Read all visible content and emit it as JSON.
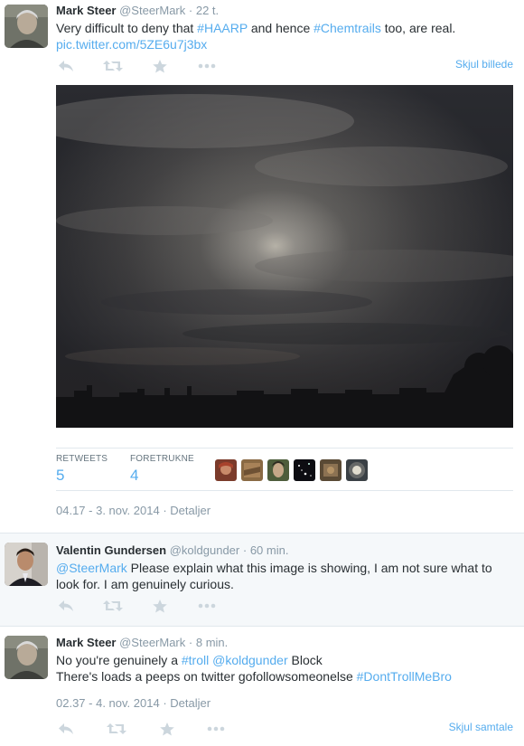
{
  "tweet_main": {
    "fullname": "Mark Steer",
    "username": "@SteerMark",
    "time": "· 22 t.",
    "text_pre": "Very difficult to deny that ",
    "hashtag1": "#HAARP",
    "text_mid": " and hence ",
    "hashtag2": "#Chemtrails",
    "text_post": " too, are real.",
    "pic_link": "pic.twitter.com/5ZE6u7j3bx",
    "hide_image": "Skjul billede",
    "retweets_label": "RETWEETS",
    "retweets_count": "5",
    "favorites_label": "FORETRUKNE",
    "favorites_count": "4",
    "timestamp": "04.17 - 3. nov. 2014",
    "details": "Detaljer"
  },
  "tweet_reply1": {
    "fullname": "Valentin Gundersen",
    "username": "@koldgunder",
    "time": "· 60 min.",
    "mention": "@SteerMark",
    "text_line1": " Please explain what this image is showing, I am not sure what to",
    "text_line2": "look for. I am genuinely curious."
  },
  "tweet_reply2": {
    "fullname": "Mark Steer",
    "username": "@SteerMark",
    "time": "· 8 min.",
    "text_pre": "No you're genuinely a ",
    "hashtag1": "#troll",
    "mention": "@koldgunder",
    "text_block": " Block",
    "line2_text": "There's loads a peeps on twitter   gofollowsomeonelse ",
    "hashtag2": "#DontTrollMeBro",
    "timestamp": "02.37 - 4. nov. 2014",
    "details": "Detaljer",
    "hide_conversation": "Skjul samtale"
  },
  "icons": {
    "reply": "reply-icon",
    "retweet": "retweet-icon",
    "favorite": "star-icon",
    "more": "more-icon"
  },
  "colors": {
    "link": "#55acee",
    "icon": "#ccd6dd",
    "muted": "#8899a6",
    "text": "#292f33",
    "reply_bg": "#f5f8fa"
  }
}
